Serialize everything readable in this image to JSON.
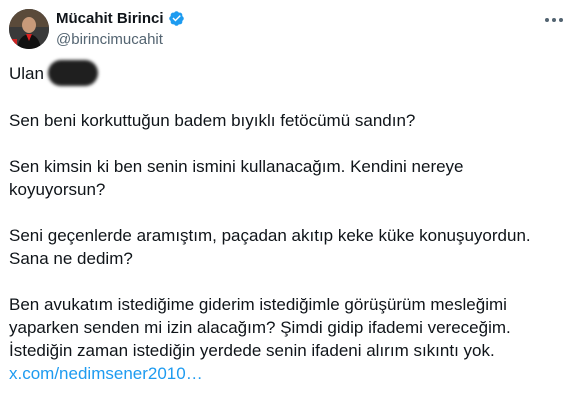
{
  "author": {
    "name": "Mücahit Birinci",
    "handle": "@birincimucahit",
    "verified": true,
    "avatar_icon": "profile-photo"
  },
  "menu": {
    "icon": "more-horizontal-icon"
  },
  "tweet": {
    "greeting": "Ulan",
    "redacted_icon": "scribble-redaction",
    "p1": "Sen beni korkuttuğun badem bıyıklı fetöcümü sandın?",
    "p2_l1": "Sen kimsin ki ben senin ismini kullanacağım. Kendini nereye",
    "p2_l2": "koyuyorsun?",
    "p3_l1": "Seni geçenlerde aramıştım, paçadan akıtıp keke küke konuşuyordun.",
    "p3_l2": "Sana ne dedim?",
    "p4_l1": "Ben avukatım istediğime giderim istediğimle görüşürüm mesleğimi",
    "p4_l2": "yaparken senden mi izin alacağım? Şimdi gidip ifademi vereceğim.",
    "p4_l3": "İstediğin zaman istediğin yerdede senin ifadeni alırım sıkıntı yok.",
    "link": "x.com/nedimsener2010…"
  },
  "colors": {
    "link": "#1d9bf0",
    "verified": "#1d9bf0",
    "secondary_text": "#536471"
  }
}
